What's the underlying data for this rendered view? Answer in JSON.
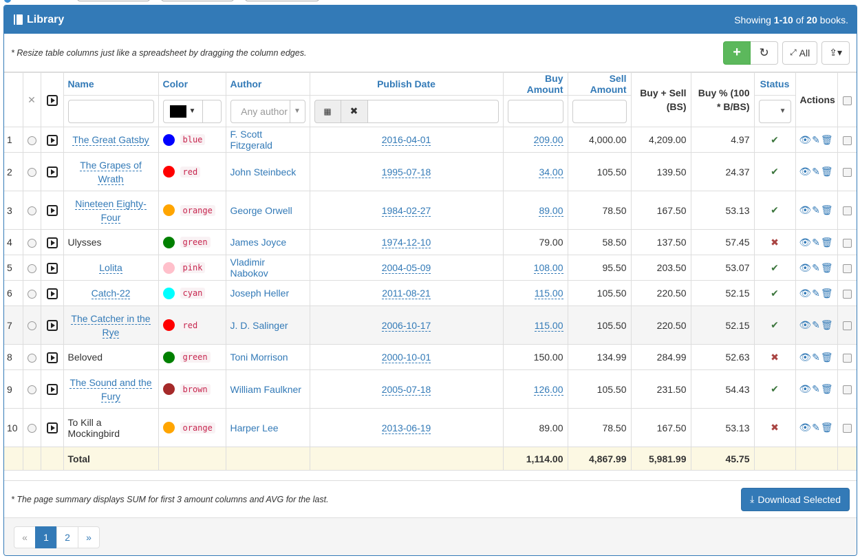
{
  "panel": {
    "title": "Library",
    "summary_prefix": "Showing ",
    "summary_range": "1-10",
    "summary_mid": " of ",
    "summary_total": "20",
    "summary_suffix": " books."
  },
  "toolbar": {
    "hint": "* Resize table columns just like a spreadsheet by dragging the column edges.",
    "add_label": "+",
    "refresh_label": "↻",
    "all_label": "All",
    "export_label": "⇪▾"
  },
  "columns": {
    "name": "Name",
    "color": "Color",
    "author": "Author",
    "publish_date": "Publish Date",
    "buy_amount": "Buy Amount",
    "sell_amount": "Sell Amount",
    "buy_sell": "Buy + Sell (BS)",
    "buy_pct": "Buy % (100 * B/BS)",
    "status": "Status",
    "actions": "Actions"
  },
  "filters": {
    "author_placeholder": "Any author"
  },
  "rows": [
    {
      "no": "1",
      "name": "The Great Gatsby",
      "name_link": true,
      "color": "blue",
      "hex": "#0000ff",
      "author": "F. Scott Fitzgerald",
      "date": "2016-04-01",
      "buy": "209.00",
      "buy_link": true,
      "sell": "4,000.00",
      "bs": "4,209.00",
      "pct": "4.97",
      "status": "ok"
    },
    {
      "no": "2",
      "name": "The Grapes of Wrath",
      "name_link": true,
      "color": "red",
      "hex": "#ff0000",
      "author": "John Steinbeck",
      "date": "1995-07-18",
      "buy": "34.00",
      "buy_link": true,
      "sell": "105.50",
      "bs": "139.50",
      "pct": "24.37",
      "status": "ok"
    },
    {
      "no": "3",
      "name": "Nineteen Eighty-Four",
      "name_link": true,
      "color": "orange",
      "hex": "#ffa500",
      "author": "George Orwell",
      "date": "1984-02-27",
      "buy": "89.00",
      "buy_link": true,
      "sell": "78.50",
      "bs": "167.50",
      "pct": "53.13",
      "status": "ok"
    },
    {
      "no": "4",
      "name": "Ulysses",
      "name_link": false,
      "color": "green",
      "hex": "#008000",
      "author": "James Joyce",
      "date": "1974-12-10",
      "buy": "79.00",
      "buy_link": false,
      "sell": "58.50",
      "bs": "137.50",
      "pct": "57.45",
      "status": "bad"
    },
    {
      "no": "5",
      "name": "Lolita",
      "name_link": true,
      "color": "pink",
      "hex": "#ffc0cb",
      "author": "Vladimir Nabokov",
      "date": "2004-05-09",
      "buy": "108.00",
      "buy_link": true,
      "sell": "95.50",
      "bs": "203.50",
      "pct": "53.07",
      "status": "ok"
    },
    {
      "no": "6",
      "name": "Catch-22",
      "name_link": true,
      "color": "cyan",
      "hex": "#00ffff",
      "author": "Joseph Heller",
      "date": "2011-08-21",
      "buy": "115.00",
      "buy_link": true,
      "sell": "105.50",
      "bs": "220.50",
      "pct": "52.15",
      "status": "ok"
    },
    {
      "no": "7",
      "name": "The Catcher in the Rye",
      "name_link": true,
      "color": "red",
      "hex": "#ff0000",
      "author": "J. D. Salinger",
      "date": "2006-10-17",
      "buy": "115.00",
      "buy_link": true,
      "sell": "105.50",
      "bs": "220.50",
      "pct": "52.15",
      "status": "ok"
    },
    {
      "no": "8",
      "name": "Beloved",
      "name_link": false,
      "color": "green",
      "hex": "#008000",
      "author": "Toni Morrison",
      "date": "2000-10-01",
      "buy": "150.00",
      "buy_link": false,
      "sell": "134.99",
      "bs": "284.99",
      "pct": "52.63",
      "status": "bad"
    },
    {
      "no": "9",
      "name": "The Sound and the Fury",
      "name_link": true,
      "color": "brown",
      "hex": "#a52a2a",
      "author": "William Faulkner",
      "date": "2005-07-18",
      "buy": "126.00",
      "buy_link": true,
      "sell": "105.50",
      "bs": "231.50",
      "pct": "54.43",
      "status": "ok"
    },
    {
      "no": "10",
      "name": "To Kill a Mockingbird",
      "name_link": false,
      "color": "orange",
      "hex": "#ffa500",
      "author": "Harper Lee",
      "date": "2013-06-19",
      "buy": "89.00",
      "buy_link": false,
      "sell": "78.50",
      "bs": "167.50",
      "pct": "53.13",
      "status": "bad"
    }
  ],
  "totals": {
    "label": "Total",
    "buy": "1,114.00",
    "sell": "4,867.99",
    "bs": "5,981.99",
    "pct": "45.75"
  },
  "footer": {
    "note": "* The page summary displays SUM for first 3 amount columns and AVG for the last.",
    "download_label": "Download Selected"
  },
  "pagination": {
    "prev": "«",
    "pages": [
      "1",
      "2"
    ],
    "active": "1",
    "next": "»"
  },
  "colors": {
    "primary": "#337ab7",
    "success": "#5cb85c",
    "danger": "#a94442",
    "ok": "#3c763d",
    "total_bg": "#fcf8e3"
  }
}
